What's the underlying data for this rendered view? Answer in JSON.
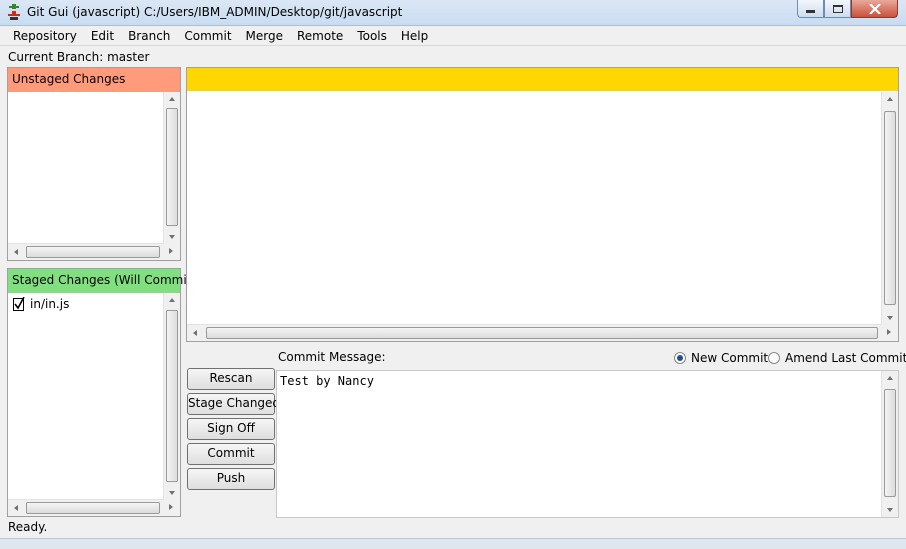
{
  "window": {
    "title": "Git Gui (javascript) C:/Users/IBM_ADMIN/Desktop/git/javascript",
    "icon": "git-gui-icon"
  },
  "menu": [
    "Repository",
    "Edit",
    "Branch",
    "Commit",
    "Merge",
    "Remote",
    "Tools",
    "Help"
  ],
  "branch_label": "Current Branch: master",
  "unstaged": {
    "title": "Unstaged Changes",
    "color": "#ff9b7b",
    "files": []
  },
  "staged": {
    "title": "Staged Changes (Will Commit)",
    "color": "#80e080",
    "files": [
      {
        "name": "in/in.js",
        "icon": "staged-file-check-icon"
      }
    ]
  },
  "diff": {
    "header_color": "#ffd700",
    "content": ""
  },
  "buttons": {
    "rescan": "Rescan",
    "stage_changed": "Stage Changed",
    "sign_off": "Sign Off",
    "commit": "Commit",
    "push": "Push"
  },
  "commit": {
    "label": "Commit Message:",
    "new_commit": "New Commit",
    "amend": "Amend Last Commit",
    "selected_mode": "new",
    "message": "Test by Nancy"
  },
  "status": "Ready."
}
